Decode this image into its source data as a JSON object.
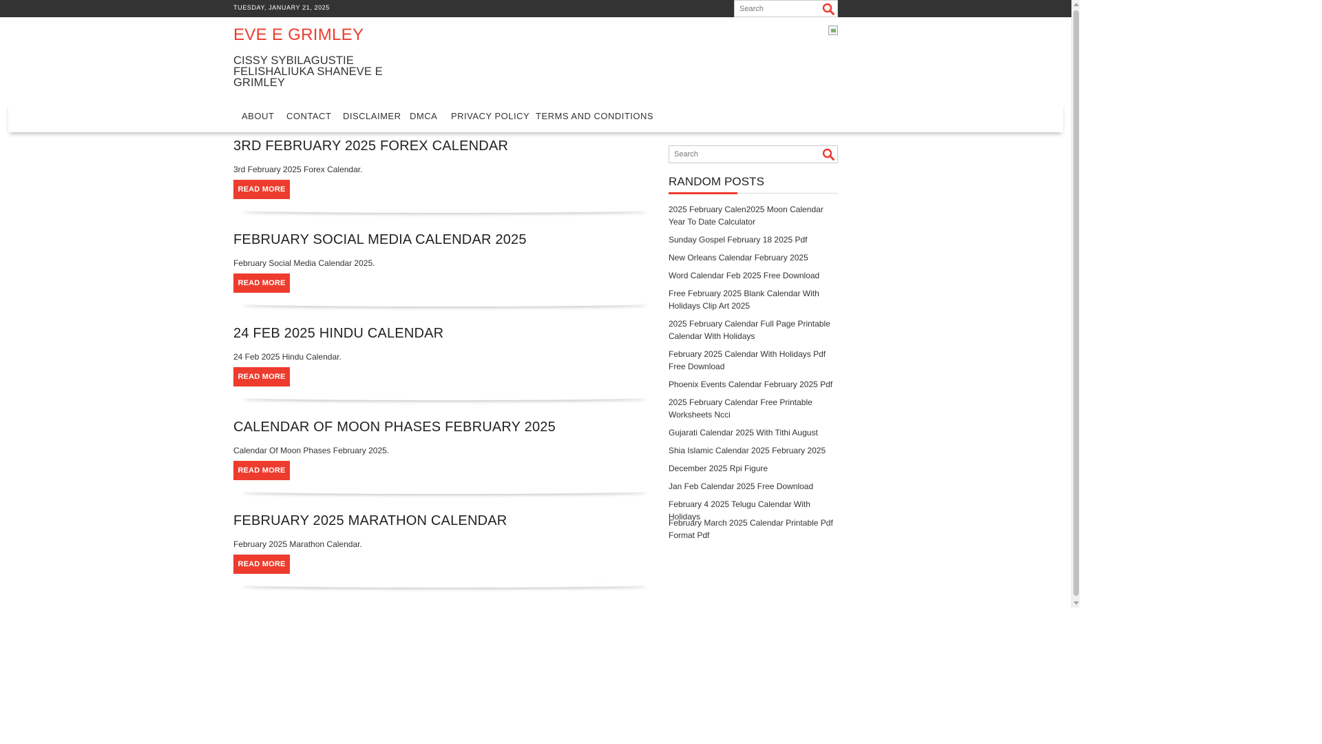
{
  "topbar": {
    "date": "TUESDAY, JANUARY 21, 2025",
    "search_placeholder": "Search"
  },
  "header": {
    "title": "EVE E GRIMLEY",
    "description": "CISSY SYBILAGUSTIE FELISHALIUKA SHANEVE E GRIMLEY"
  },
  "nav": {
    "items": [
      {
        "label": "ABOUT"
      },
      {
        "label": "CONTACT"
      },
      {
        "label": "DISCLAIMER"
      },
      {
        "label": "DMCA"
      },
      {
        "label": "PRIVACY POLICY"
      },
      {
        "label": "TERMS AND CONDITIONS"
      }
    ]
  },
  "posts": [
    {
      "title": "3RD FEBRUARY 2025 FOREX CALENDAR",
      "excerpt": "3rd February 2025 Forex Calendar.",
      "button": "READ MORE"
    },
    {
      "title": "FEBRUARY SOCIAL MEDIA CALENDAR 2025",
      "excerpt": "February Social Media Calendar 2025.",
      "button": "READ MORE"
    },
    {
      "title": "24 FEB 2025 HINDU CALENDAR",
      "excerpt": "24 Feb 2025 Hindu Calendar.",
      "button": "READ MORE"
    },
    {
      "title": "CALENDAR OF MOON PHASES FEBRUARY 2025",
      "excerpt": "Calendar Of Moon Phases February 2025.",
      "button": "READ MORE"
    },
    {
      "title": "FEBRUARY 2025 MARATHON CALENDAR",
      "excerpt": "February 2025 Marathon Calendar.",
      "button": "READ MORE"
    }
  ],
  "sidebar": {
    "search_placeholder": "Search",
    "widget_title": "RANDOM POSTS",
    "random_posts": [
      "2025 February Calen2025 Moon Calendar Year To Date Calculator",
      "Sunday Gospel February 18 2025 Pdf",
      "New Orleans Calendar February 2025",
      "Word Calendar Feb 2025 Free Download",
      "Free February 2025 Blank Calendar With Holidays Clip Art 2025",
      "2025 February Calendar Full Page Printable Calendar With Holidays",
      "February 2025 Calendar With Holidays Pdf Free Download",
      "Phoenix Events Calendar February 2025 Pdf",
      "2025 February Calendar Free Printable Worksheets Ncci",
      "Gujarati Calendar 2025 With Tithi August",
      "Shia Islamic Calendar 2025 February 2025",
      "December 2025 Rpi Figure",
      "Jan Feb Calendar 2025 Free Download",
      "February 4 2025 Telugu Calendar With Holidays",
      "February March 2025 Calendar Printable Pdf Format Pdf"
    ]
  },
  "colors": {
    "accent": "#ed3c2d",
    "topbar": "#333333"
  },
  "icons": {
    "search": "search-icon",
    "header_image": "broken-image-icon"
  }
}
